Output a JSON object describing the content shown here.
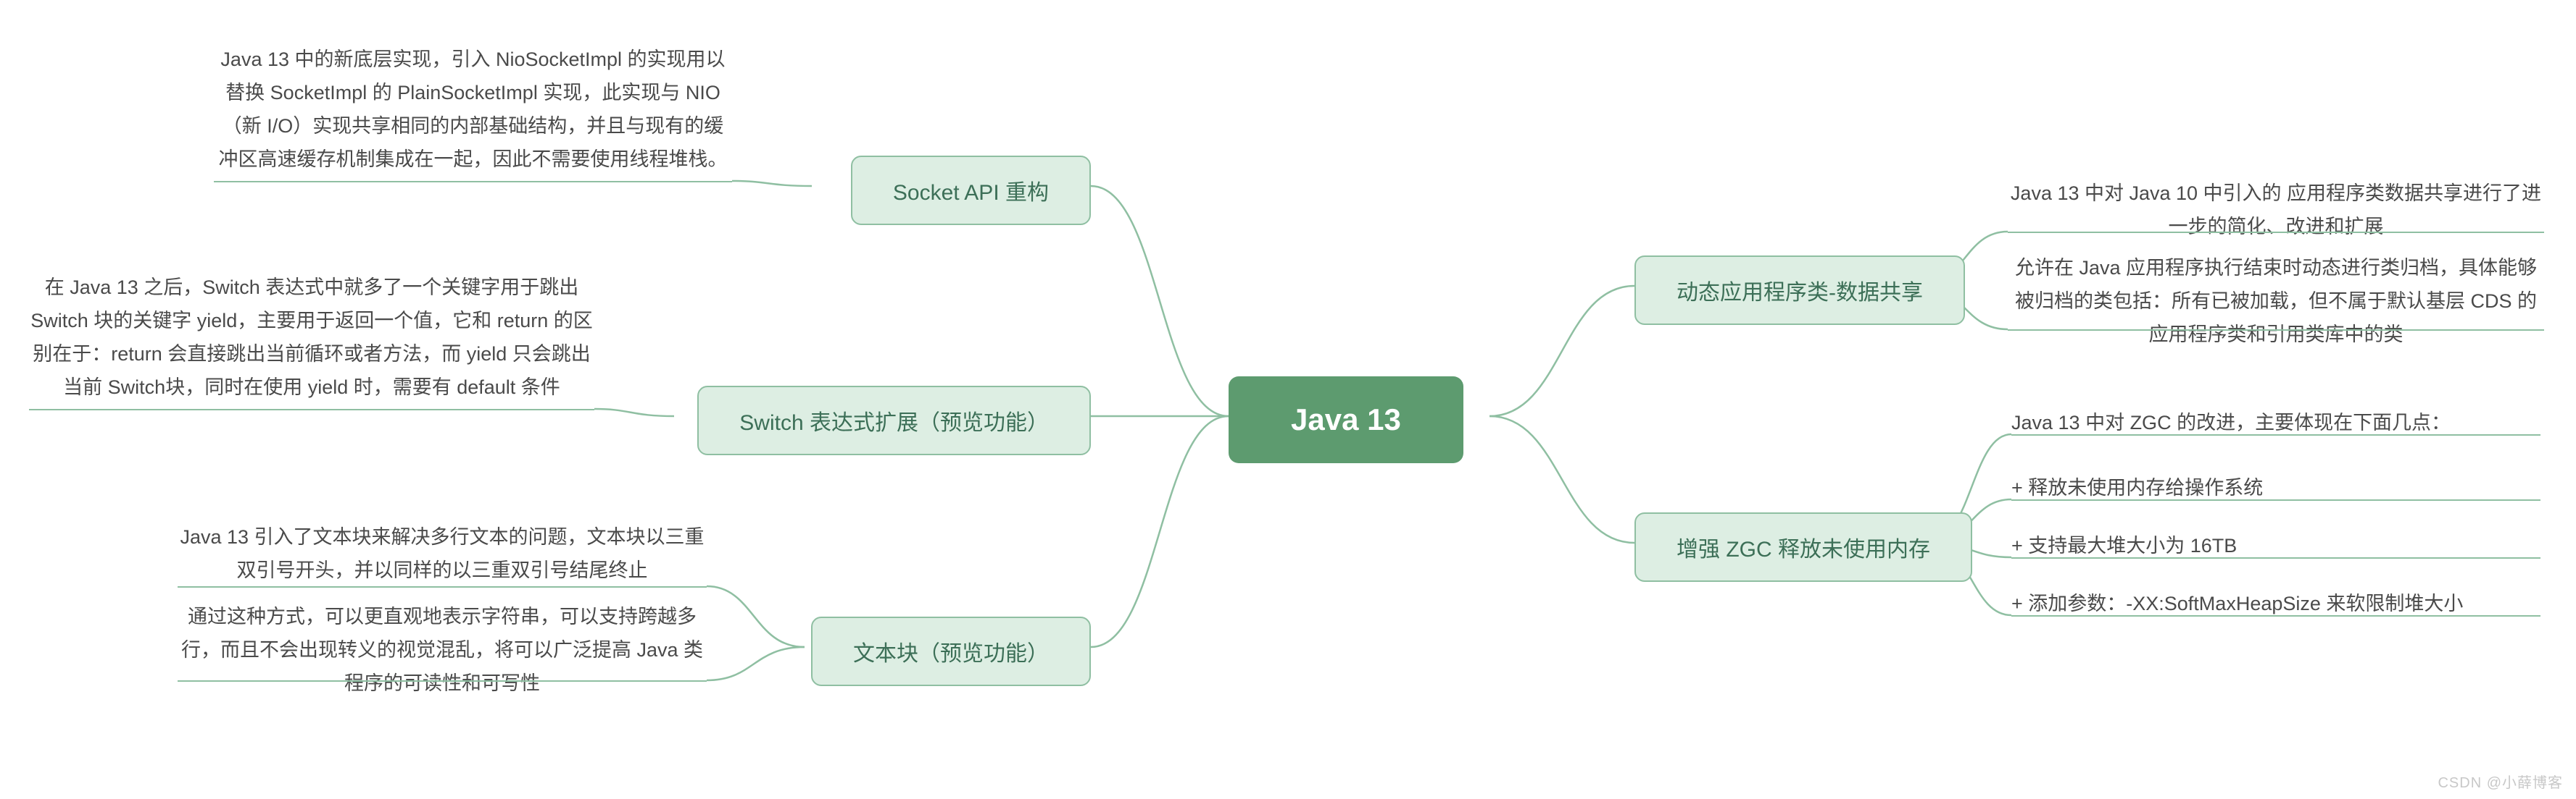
{
  "center": {
    "title": "Java 13"
  },
  "left": {
    "b1": {
      "label": "Socket API 重构",
      "leaves": [
        "Java 13 中的新底层实现，引入 NioSocketImpl 的实现用以替换 SocketImpl 的 PlainSocketImpl 实现，此实现与 NIO（新 I/O）实现共享相同的内部基础结构，并且与现有的缓冲区高速缓存机制集成在一起，因此不需要使用线程堆栈。"
      ]
    },
    "b2": {
      "label": "Switch 表达式扩展（预览功能）",
      "leaves": [
        "在 Java 13 之后，Switch 表达式中就多了一个关键字用于跳出 Switch 块的关键字 yield，主要用于返回一个值，它和 return 的区别在于：return 会直接跳出当前循环或者方法，而 yield 只会跳出当前 Switch块，同时在使用 yield 时，需要有 default 条件"
      ]
    },
    "b3": {
      "label": "文本块（预览功能）",
      "leaves": [
        "Java 13 引入了文本块来解决多行文本的问题，文本块以三重双引号开头，并以同样的以三重双引号结尾终止",
        "通过这种方式，可以更直观地表示字符串，可以支持跨越多行，而且不会出现转义的视觉混乱，将可以广泛提高 Java 类程序的可读性和可写性"
      ]
    }
  },
  "right": {
    "b4": {
      "label": "动态应用程序类-数据共享",
      "leaves": [
        "Java 13 中对 Java 10 中引入的 应用程序类数据共享进行了进一步的简化、改进和扩展",
        "允许在 Java 应用程序执行结束时动态进行类归档，具体能够被归档的类包括：所有已被加载，但不属于默认基层 CDS 的应用程序类和引用类库中的类"
      ]
    },
    "b5": {
      "label": "增强 ZGC 释放未使用内存",
      "leaves": [
        "Java 13 中对 ZGC 的改进，主要体现在下面几点：",
        "+ 释放未使用内存给操作系统",
        "+ 支持最大堆大小为 16TB",
        "+ 添加参数：-XX:SoftMaxHeapSize 来软限制堆大小"
      ]
    }
  },
  "watermark": "CSDN @小薛博客"
}
